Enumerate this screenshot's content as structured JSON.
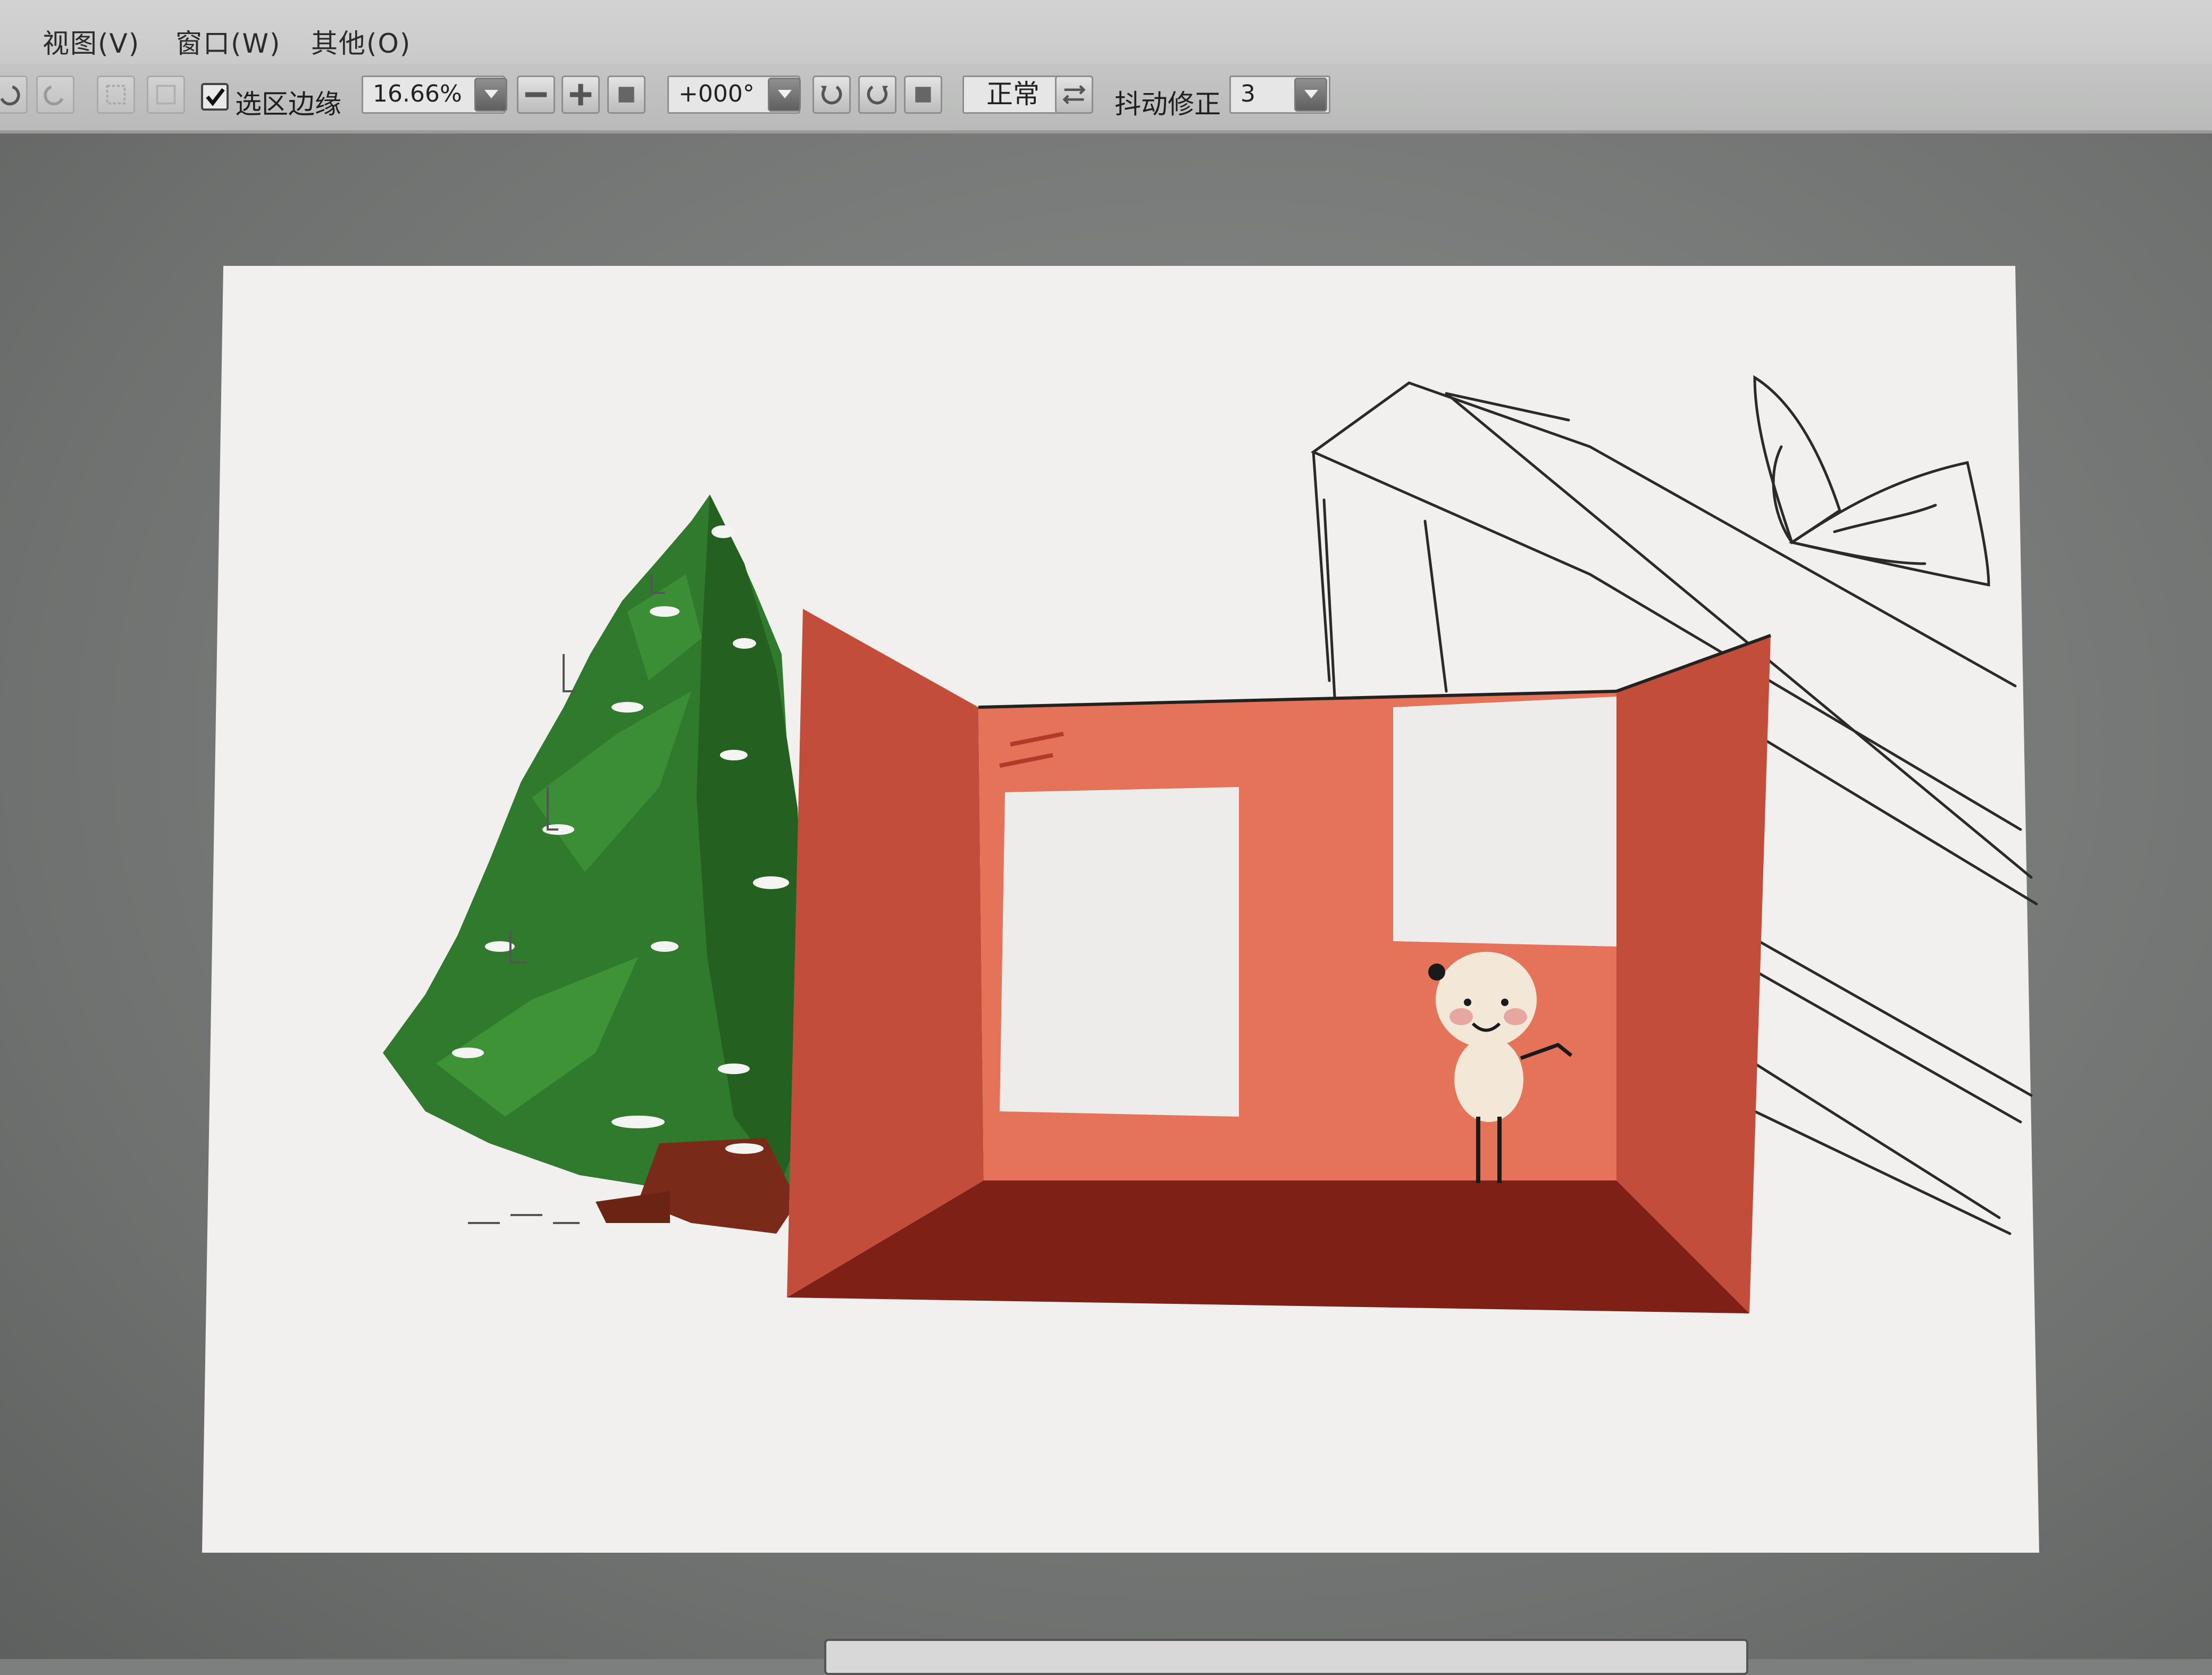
{
  "menu": {
    "view": "视图(V)",
    "window": "窗口(W)",
    "other": "其他(O)"
  },
  "toolbar": {
    "selection_edge_label": "选区边缘",
    "selection_edge_checked": true,
    "zoom_value": "16.66%",
    "rotation_value": "+000°",
    "mode_value": "正常",
    "stabilizer_label": "抖动修正",
    "stabilizer_value": "3"
  },
  "colors": {
    "box_red": "#c24d3a",
    "box_back": "#e5735a",
    "box_floor": "#7e2016",
    "tree_green": "#2f7a2c",
    "paper": "#f1f0ee"
  },
  "icons": {
    "zoom_out": "minus-icon",
    "zoom_in": "plus-icon",
    "rotate_left": "rotate-left-icon",
    "rotate_right": "rotate-right-icon",
    "flip": "flip-icon"
  }
}
